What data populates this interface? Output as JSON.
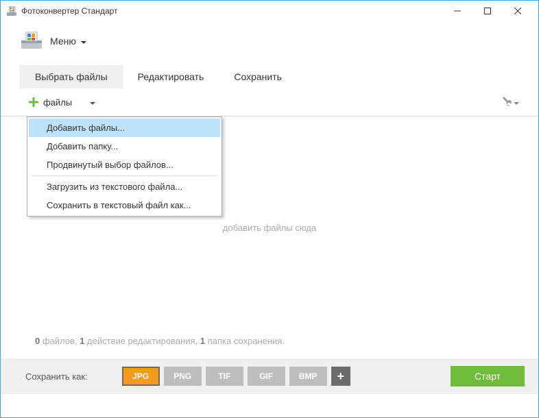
{
  "title": "Фотоконвертер Стандарт",
  "menu": {
    "label": "Меню"
  },
  "tabs": {
    "select": "Выбрать файлы",
    "edit": "Редактировать",
    "save": "Сохранить"
  },
  "toolbar": {
    "add_files": "файлы"
  },
  "dropdown": {
    "add_files": "Добавить файлы...",
    "add_folder": "Добавить папку...",
    "advanced_select": "Продвинутый выбор файлов...",
    "load_from_text": "Загрузить из текстового файла...",
    "save_to_text": "Сохранить в текстовый файл как..."
  },
  "main": {
    "drop_hint": "добавить файлы сюда"
  },
  "status": {
    "files_count": "0",
    "files_word": "файлов,",
    "edits_count": "1",
    "edits_word": "действие редактирования,",
    "folders_count": "1",
    "folders_word": "папка сохранения."
  },
  "footer": {
    "save_as": "Сохранить как:",
    "formats": {
      "jpg": "JPG",
      "png": "PNG",
      "tif": "TIF",
      "gif": "GIF",
      "bmp": "BMP"
    },
    "start": "Старт"
  }
}
